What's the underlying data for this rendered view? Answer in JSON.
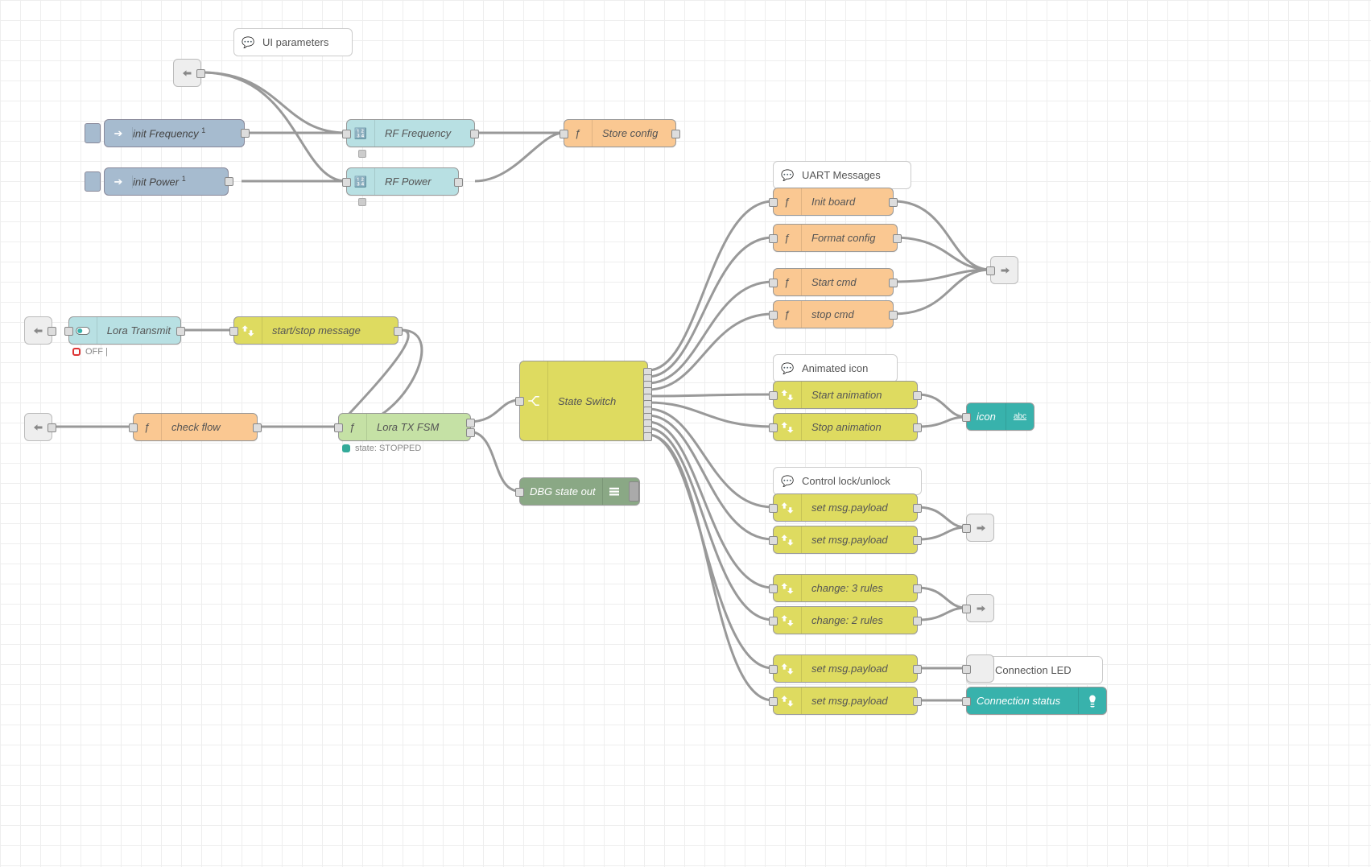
{
  "comments": {
    "uiParams": "UI parameters",
    "uartMsgs": "UART Messages",
    "animIcon": "Animated icon",
    "controlLock": "Control lock/unlock",
    "connLed": "Connection LED"
  },
  "injects": {
    "initFreq": "init Frequency ",
    "initPower": "init Power "
  },
  "injectBadge": "1",
  "nodes": {
    "rfFreq": "RF Frequency",
    "rfPower": "RF Power",
    "storeConfig": "Store config",
    "loraTransmit": "Lora Transmit",
    "startStop": "start/stop message",
    "checkFlow": "check flow",
    "loraFsm": "Lora TX FSM",
    "stateSwitch": "State Switch",
    "dbgOut": "DBG state out",
    "initBoard": "Init board",
    "formatConfig": "Format config",
    "startCmd": "Start cmd",
    "stopCmd": "stop cmd",
    "startAnim": "Start animation",
    "stopAnim": "Stop animation",
    "iconText": "icon",
    "setPayload1": "set msg.payload",
    "setPayload2": "set msg.payload",
    "change3": "change: 3 rules",
    "change2": "change: 2 rules",
    "setPayload3": "set msg.payload",
    "setPayload4": "set msg.payload",
    "connStatus": "Connection status"
  },
  "status": {
    "loraOff": "OFF |",
    "fsmState": "state: STOPPED"
  }
}
